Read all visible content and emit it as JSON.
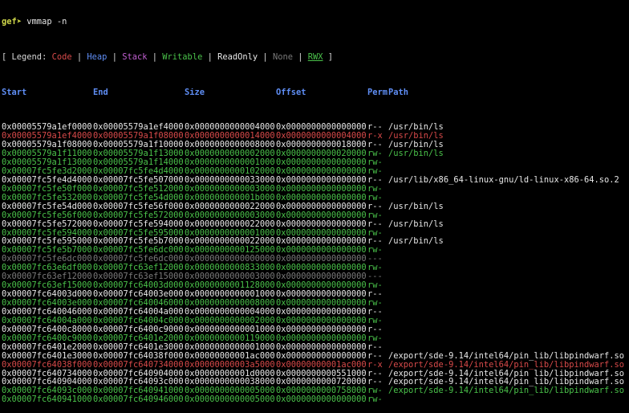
{
  "prompt": {
    "tag": "gef➤",
    "command": "vmmap -n"
  },
  "legend": {
    "open": "[",
    "title": "Legend:",
    "close": "]",
    "items": [
      {
        "label": "Code",
        "color": "#d84a4a"
      },
      {
        "label": "Heap",
        "color": "#5f8ef5"
      },
      {
        "label": "Stack",
        "color": "#c05fd0"
      },
      {
        "label": "Writable",
        "color": "#4ac24a"
      },
      {
        "label": "ReadOnly",
        "color": "#e8e8e8"
      },
      {
        "label": "None",
        "color": "#7a7a7a"
      },
      {
        "label": "RWX",
        "color": "#4ac24a"
      }
    ]
  },
  "headers": {
    "start": "Start",
    "end": "End",
    "size": "Size",
    "offset": "Offset",
    "perm": "Perm",
    "path": "Path"
  },
  "colors": {
    "readonly": "#e8e8e8",
    "writable": "#4ac24a",
    "code": "#d84a4a",
    "none": "#7a7a7a",
    "header": "#5f8ef5",
    "prompt": "#d0d84a"
  },
  "rows": [
    {
      "start": "0x00005579a1ef0000",
      "end": "0x00005579a1ef4000",
      "size": "0x0000000000004000",
      "offset": "0x0000000000000000",
      "perm": "r--",
      "path": "/usr/bin/ls",
      "kind": "readonly"
    },
    {
      "start": "0x00005579a1ef4000",
      "end": "0x00005579a1f08000",
      "size": "0x0000000000014000",
      "offset": "0x0000000000004000",
      "perm": "r-x",
      "path": "/usr/bin/ls",
      "kind": "code"
    },
    {
      "start": "0x00005579a1f08000",
      "end": "0x00005579a1f10000",
      "size": "0x0000000000008000",
      "offset": "0x0000000000018000",
      "perm": "r--",
      "path": "/usr/bin/ls",
      "kind": "readonly"
    },
    {
      "start": "0x00005579a1f11000",
      "end": "0x00005579a1f13000",
      "size": "0x0000000000002000",
      "offset": "0x0000000000020000",
      "perm": "rw-",
      "path": "/usr/bin/ls",
      "kind": "writable"
    },
    {
      "start": "0x00005579a1f13000",
      "end": "0x00005579a1f14000",
      "size": "0x0000000000001000",
      "offset": "0x0000000000000000",
      "perm": "rw-",
      "path": "",
      "kind": "writable"
    },
    {
      "start": "0x00007fc5fe3d2000",
      "end": "0x00007fc5fe4d4000",
      "size": "0x0000000000102000",
      "offset": "0x0000000000000000",
      "perm": "rw-",
      "path": "",
      "kind": "writable"
    },
    {
      "start": "0x00007fc5fe4d4000",
      "end": "0x00007fc5fe507000",
      "size": "0x0000000000033000",
      "offset": "0x0000000000000000",
      "perm": "r--",
      "path": "/usr/lib/x86_64-linux-gnu/ld-linux-x86-64.so.2",
      "kind": "readonly"
    },
    {
      "start": "0x00007fc5fe50f000",
      "end": "0x00007fc5fe512000",
      "size": "0x0000000000003000",
      "offset": "0x0000000000000000",
      "perm": "rw-",
      "path": "",
      "kind": "writable"
    },
    {
      "start": "0x00007fc5fe532000",
      "end": "0x00007fc5fe54d000",
      "size": "0x000000000001b000",
      "offset": "0x0000000000000000",
      "perm": "rw-",
      "path": "",
      "kind": "writable"
    },
    {
      "start": "0x00007fc5fe54d000",
      "end": "0x00007fc5fe56f000",
      "size": "0x0000000000022000",
      "offset": "0x0000000000000000",
      "perm": "r--",
      "path": "/usr/bin/ls",
      "kind": "readonly"
    },
    {
      "start": "0x00007fc5fe56f000",
      "end": "0x00007fc5fe572000",
      "size": "0x0000000000003000",
      "offset": "0x0000000000000000",
      "perm": "rw-",
      "path": "",
      "kind": "writable"
    },
    {
      "start": "0x00007fc5fe572000",
      "end": "0x00007fc5fe594000",
      "size": "0x0000000000022000",
      "offset": "0x0000000000000000",
      "perm": "r--",
      "path": "/usr/bin/ls",
      "kind": "readonly"
    },
    {
      "start": "0x00007fc5fe594000",
      "end": "0x00007fc5fe595000",
      "size": "0x0000000000001000",
      "offset": "0x0000000000000000",
      "perm": "rw-",
      "path": "",
      "kind": "writable"
    },
    {
      "start": "0x00007fc5fe595000",
      "end": "0x00007fc5fe5b7000",
      "size": "0x0000000000022000",
      "offset": "0x0000000000000000",
      "perm": "r--",
      "path": "/usr/bin/ls",
      "kind": "readonly"
    },
    {
      "start": "0x00007fc5fe5b7000",
      "end": "0x00007fc5fe6dc000",
      "size": "0x0000000000125000",
      "offset": "0x0000000000000000",
      "perm": "rw-",
      "path": "",
      "kind": "writable"
    },
    {
      "start": "0x00007fc5fe6dc000",
      "end": "0x00007fc5fe6dc000",
      "size": "0x0000000000000000",
      "offset": "0x0000000000000000",
      "perm": "---",
      "path": "",
      "kind": "none"
    },
    {
      "start": "0x00007fc63e6df000",
      "end": "0x00007fc63ef12000",
      "size": "0x0000000000833000",
      "offset": "0x0000000000000000",
      "perm": "rw-",
      "path": "",
      "kind": "writable"
    },
    {
      "start": "0x00007fc63ef12000",
      "end": "0x00007fc63ef15000",
      "size": "0x0000000000003000",
      "offset": "0x0000000000000000",
      "perm": "---",
      "path": "",
      "kind": "none"
    },
    {
      "start": "0x00007fc63ef15000",
      "end": "0x00007fc64003d000",
      "size": "0x0000000001128000",
      "offset": "0x0000000000000000",
      "perm": "rw-",
      "path": "",
      "kind": "writable"
    },
    {
      "start": "0x00007fc64003d000",
      "end": "0x00007fc64003e000",
      "size": "0x0000000000001000",
      "offset": "0x0000000000000000",
      "perm": "r--",
      "path": "",
      "kind": "readonly"
    },
    {
      "start": "0x00007fc64003e000",
      "end": "0x00007fc640046000",
      "size": "0x0000000000008000",
      "offset": "0x0000000000000000",
      "perm": "rw-",
      "path": "",
      "kind": "writable"
    },
    {
      "start": "0x00007fc640046000",
      "end": "0x00007fc64004a000",
      "size": "0x0000000000004000",
      "offset": "0x0000000000000000",
      "perm": "r--",
      "path": "",
      "kind": "readonly"
    },
    {
      "start": "0x00007fc64004a000",
      "end": "0x00007fc64004c000",
      "size": "0x0000000000002000",
      "offset": "0x0000000000000000",
      "perm": "rw-",
      "path": "",
      "kind": "writable"
    },
    {
      "start": "0x00007fc6400c8000",
      "end": "0x00007fc6400c9000",
      "size": "0x0000000000001000",
      "offset": "0x0000000000000000",
      "perm": "r--",
      "path": "",
      "kind": "readonly"
    },
    {
      "start": "0x00007fc6400c9000",
      "end": "0x00007fc6401e2000",
      "size": "0x0000000000119000",
      "offset": "0x0000000000000000",
      "perm": "rw-",
      "path": "",
      "kind": "writable"
    },
    {
      "start": "0x00007fc6401e2000",
      "end": "0x00007fc6401e3000",
      "size": "0x0000000000001000",
      "offset": "0x0000000000000000",
      "perm": "r--",
      "path": "",
      "kind": "readonly"
    },
    {
      "start": "0x00007fc6401e3000",
      "end": "0x00007fc64038f000",
      "size": "0x00000000001ac000",
      "offset": "0x0000000000000000",
      "perm": "r--",
      "path": "/export/sde-9.14/intel64/pin_lib/libpindwarf.so",
      "kind": "readonly"
    },
    {
      "start": "0x00007fc64038f000",
      "end": "0x00007fc640734000",
      "size": "0x00000000003a5000",
      "offset": "0x00000000001ac000",
      "perm": "r-x",
      "path": "/export/sde-9.14/intel64/pin_lib/libpindwarf.so",
      "kind": "code"
    },
    {
      "start": "0x00007fc640734000",
      "end": "0x00007fc640904000",
      "size": "0x00000000001d0000",
      "offset": "0x0000000000551000",
      "perm": "r--",
      "path": "/export/sde-9.14/intel64/pin_lib/libpindwarf.so",
      "kind": "readonly"
    },
    {
      "start": "0x00007fc640904000",
      "end": "0x00007fc64093c000",
      "size": "0x0000000000038000",
      "offset": "0x0000000000720000",
      "perm": "r--",
      "path": "/export/sde-9.14/intel64/pin_lib/libpindwarf.so",
      "kind": "readonly"
    },
    {
      "start": "0x00007fc64093c000",
      "end": "0x00007fc640941000",
      "size": "0x0000000000005000",
      "offset": "0x0000000000758000",
      "perm": "rw-",
      "path": "/export/sde-9.14/intel64/pin_lib/libpindwarf.so",
      "kind": "writable"
    },
    {
      "start": "0x00007fc640941000",
      "end": "0x00007fc640946000",
      "size": "0x0000000000005000",
      "offset": "0x0000000000000000",
      "perm": "rw-",
      "path": "",
      "kind": "writable"
    }
  ]
}
